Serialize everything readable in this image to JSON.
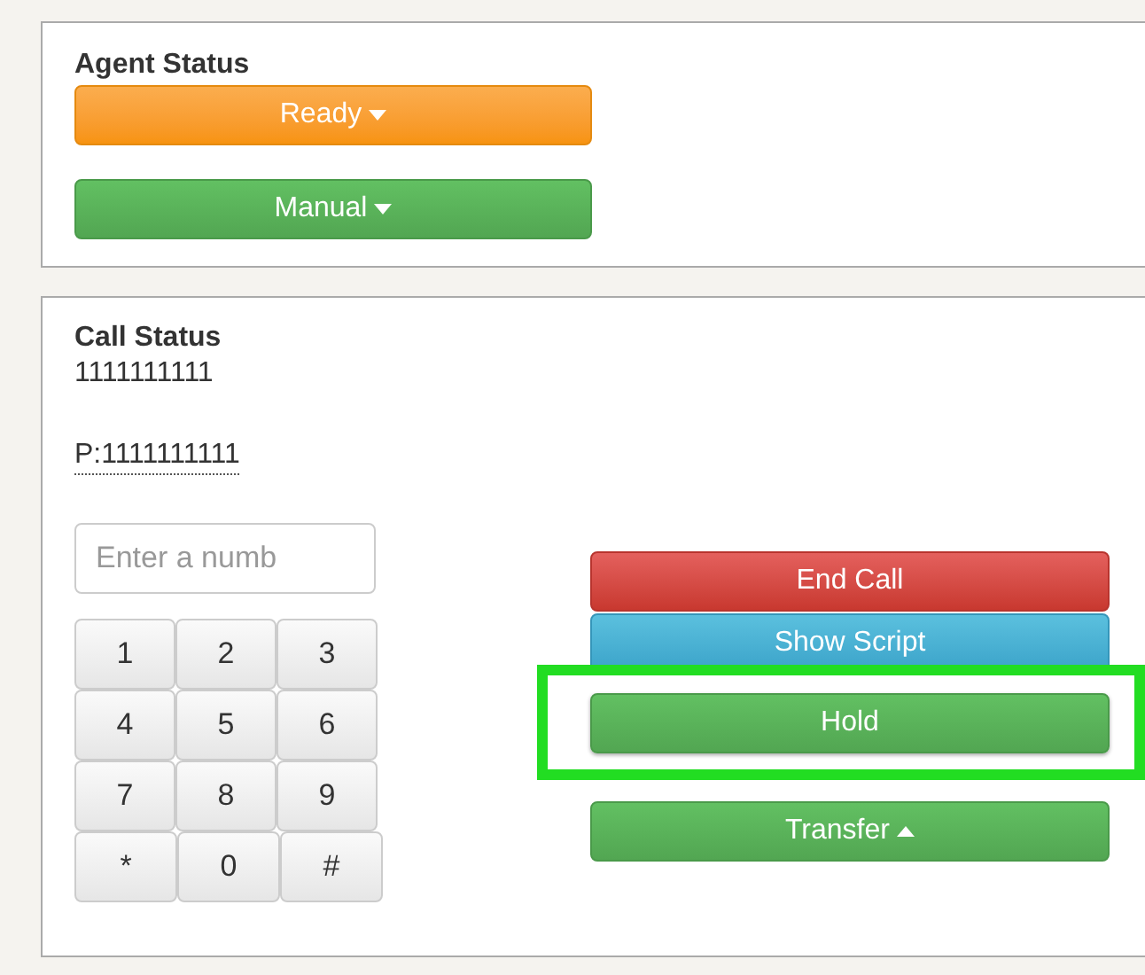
{
  "agent_status": {
    "title": "Agent Status",
    "buttons": [
      {
        "label": "Ready",
        "kind": "warning"
      },
      {
        "label": "Manual",
        "kind": "success"
      }
    ]
  },
  "call_status": {
    "title": "Call Status",
    "number": "1111111111",
    "phone": "P:1111111111",
    "dial_field": {
      "placeholder": "Enter a numb"
    },
    "keypad": [
      [
        "1",
        "2",
        "3"
      ],
      [
        "4",
        "5",
        "6"
      ],
      [
        "7",
        "8",
        "9"
      ],
      [
        "*",
        "0",
        "#"
      ]
    ],
    "actions": [
      {
        "label": "End Call",
        "kind": "danger",
        "highlighted": false,
        "caret": false
      },
      {
        "label": "Show Script",
        "kind": "info",
        "highlighted": false,
        "caret": false
      },
      {
        "label": "Hold",
        "kind": "success",
        "highlighted": true,
        "caret": false
      },
      {
        "label": "Transfer",
        "kind": "success",
        "highlighted": false,
        "caret": true
      }
    ]
  }
}
